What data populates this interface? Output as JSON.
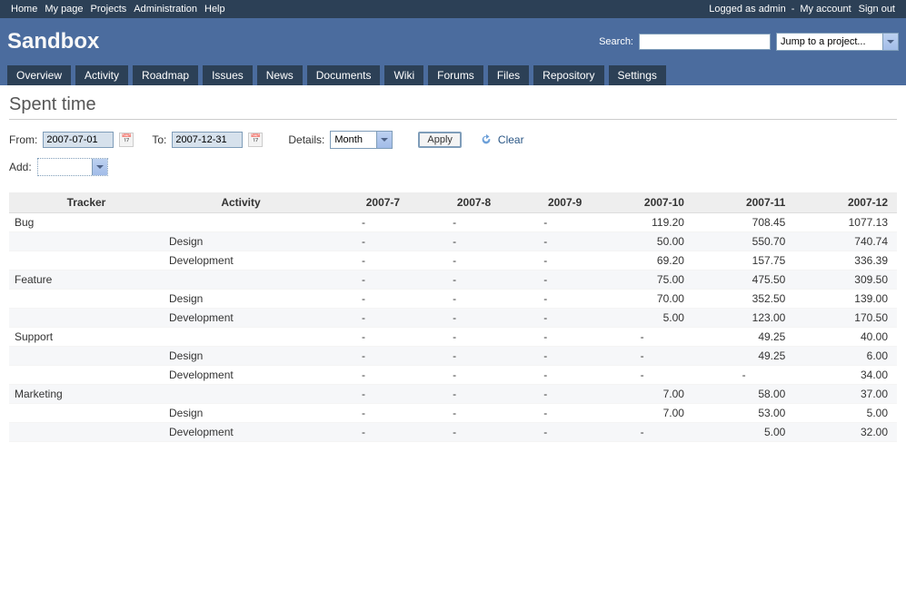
{
  "top_menu": {
    "left": [
      "Home",
      "My page",
      "Projects",
      "Administration",
      "Help"
    ],
    "logged": "Logged as admin",
    "right": [
      "My account",
      "Sign out"
    ]
  },
  "header": {
    "title": "Sandbox",
    "search_label": "Search:",
    "search_value": "",
    "project_select": "Jump to a project..."
  },
  "tabs": [
    "Overview",
    "Activity",
    "Roadmap",
    "Issues",
    "News",
    "Documents",
    "Wiki",
    "Forums",
    "Files",
    "Repository",
    "Settings"
  ],
  "page_title": "Spent time",
  "filters": {
    "from_label": "From:",
    "from_value": "2007-07-01",
    "to_label": "To:",
    "to_value": "2007-12-31",
    "details_label": "Details:",
    "details_value": "Month",
    "apply": "Apply",
    "clear": "Clear"
  },
  "add": {
    "label": "Add:",
    "value": ""
  },
  "table": {
    "headers": [
      "Tracker",
      "Activity",
      "2007-7",
      "2007-8",
      "2007-9",
      "2007-10",
      "2007-11",
      "2007-12"
    ],
    "rows": [
      {
        "tracker": "Bug",
        "activity": "",
        "m": [
          "-",
          "-",
          "-",
          "119.20",
          "708.45",
          "1077.13"
        ]
      },
      {
        "tracker": "",
        "activity": "Design",
        "m": [
          "-",
          "-",
          "-",
          "50.00",
          "550.70",
          "740.74"
        ]
      },
      {
        "tracker": "",
        "activity": "Development",
        "m": [
          "-",
          "-",
          "-",
          "69.20",
          "157.75",
          "336.39"
        ]
      },
      {
        "tracker": "Feature",
        "activity": "",
        "m": [
          "-",
          "-",
          "-",
          "75.00",
          "475.50",
          "309.50"
        ]
      },
      {
        "tracker": "",
        "activity": "Design",
        "m": [
          "-",
          "-",
          "-",
          "70.00",
          "352.50",
          "139.00"
        ]
      },
      {
        "tracker": "",
        "activity": "Development",
        "m": [
          "-",
          "-",
          "-",
          "5.00",
          "123.00",
          "170.50"
        ]
      },
      {
        "tracker": "Support",
        "activity": "",
        "m": [
          "-",
          "-",
          "-",
          "-",
          "49.25",
          "40.00"
        ]
      },
      {
        "tracker": "",
        "activity": "Design",
        "m": [
          "-",
          "-",
          "-",
          "-",
          "49.25",
          "6.00"
        ]
      },
      {
        "tracker": "",
        "activity": "Development",
        "m": [
          "-",
          "-",
          "-",
          "-",
          "-",
          "34.00"
        ]
      },
      {
        "tracker": "Marketing",
        "activity": "",
        "m": [
          "-",
          "-",
          "-",
          "7.00",
          "58.00",
          "37.00"
        ]
      },
      {
        "tracker": "",
        "activity": "Design",
        "m": [
          "-",
          "-",
          "-",
          "7.00",
          "53.00",
          "5.00"
        ]
      },
      {
        "tracker": "",
        "activity": "Development",
        "m": [
          "-",
          "-",
          "-",
          "-",
          "5.00",
          "32.00"
        ]
      }
    ]
  }
}
